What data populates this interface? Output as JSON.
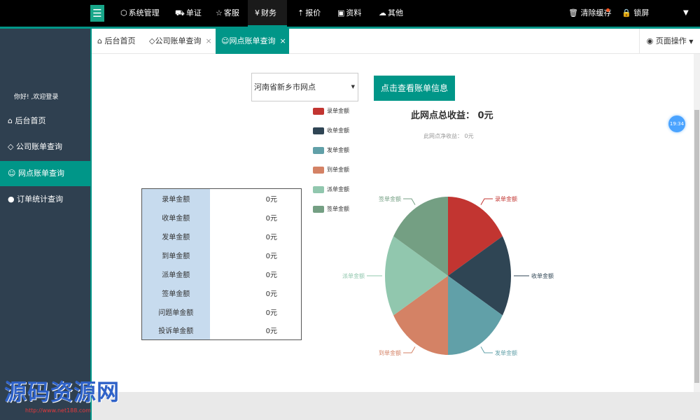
{
  "topnav": {
    "items": [
      {
        "icon": "cube-icon",
        "glyph": "⬡",
        "label": "系统管理"
      },
      {
        "icon": "bus-icon",
        "glyph": "⛟",
        "label": "单证"
      },
      {
        "icon": "star-icon",
        "glyph": "☆",
        "label": "客服"
      },
      {
        "icon": "yen-icon",
        "glyph": "¥",
        "label": "财务"
      },
      {
        "icon": "arrow-up-icon",
        "glyph": "⇡",
        "label": "报价"
      },
      {
        "icon": "document-icon",
        "glyph": "▣",
        "label": "资料"
      },
      {
        "icon": "cloud-upload-icon",
        "glyph": "☁",
        "label": "其他"
      }
    ],
    "clear_cache": "清除缓存",
    "lock": "锁屏"
  },
  "sidebar": {
    "welcome": "你好!       ,欢迎登录",
    "items": [
      {
        "glyph": "⌂",
        "label": "后台首页"
      },
      {
        "glyph": "◇",
        "label": "公司账单查询"
      },
      {
        "glyph": "☺",
        "label": "网点账单查询"
      },
      {
        "glyph": "●",
        "label": "订单统计查询"
      }
    ]
  },
  "tabs": {
    "items": [
      {
        "glyph": "⌂",
        "label": "后台首页"
      },
      {
        "glyph": "◇",
        "label": "公司账单查询",
        "close": "×"
      },
      {
        "glyph": "☺",
        "label": "网点账单查询",
        "close": "×"
      }
    ],
    "page_ops": "页面操作"
  },
  "query": {
    "select_value": "河南省新乡市网点",
    "button": "点击查看账单信息"
  },
  "summary": {
    "total": "此网点总收益：  0元",
    "net": "此网点净收益：  0元"
  },
  "table": {
    "rows": [
      {
        "label": "录单金额",
        "value": "0元"
      },
      {
        "label": "收单金额",
        "value": "0元"
      },
      {
        "label": "发单金额",
        "value": "0元"
      },
      {
        "label": "到单金额",
        "value": "0元"
      },
      {
        "label": "派单金额",
        "value": "0元"
      },
      {
        "label": "签单金额",
        "value": "0元"
      },
      {
        "label": "问题单金额",
        "value": "0元"
      },
      {
        "label": "投诉单金额",
        "value": "0元"
      }
    ]
  },
  "chart_data": {
    "type": "pie",
    "categories": [
      "录单金额",
      "收单金额",
      "发单金额",
      "到单金额",
      "派单金额",
      "签单金额"
    ],
    "values": [
      1,
      1,
      1,
      1,
      1,
      1
    ],
    "colors": [
      "#c23531",
      "#2f4554",
      "#61a0a8",
      "#d48265",
      "#91c7ae",
      "#749f83"
    ],
    "legend_position": "top-left"
  },
  "time_badge": "19:34",
  "watermark": {
    "text": "源码资源网",
    "url": "http://www.net188.com"
  }
}
